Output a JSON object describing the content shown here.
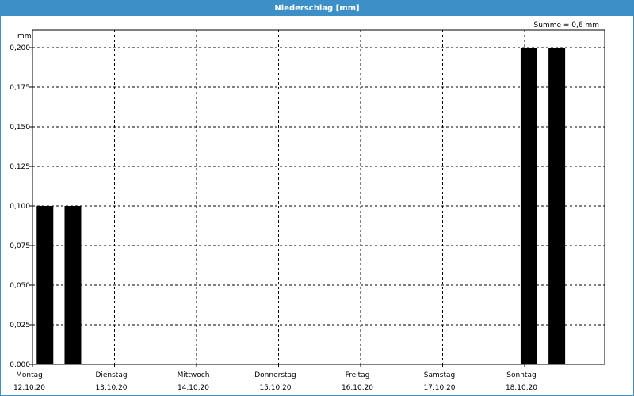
{
  "window": {
    "title": "Niederschlag [mm]"
  },
  "chart_data": {
    "type": "bar",
    "title": "Niederschlag [mm]",
    "unit_label": "mm",
    "sum_label": "Summe = 0,6 mm",
    "ylim": [
      0,
      0.2
    ],
    "y_ticks": [
      "0,000",
      "0,025",
      "0,050",
      "0,075",
      "0,100",
      "0,125",
      "0,150",
      "0,175",
      "0,200"
    ],
    "x_labels": [
      {
        "day": "Montag",
        "date": "12.10.20"
      },
      {
        "day": "Dienstag",
        "date": "13.10.20"
      },
      {
        "day": "Mittwoch",
        "date": "14.10.20"
      },
      {
        "day": "Donnerstag",
        "date": "15.10.20"
      },
      {
        "day": "Freitag",
        "date": "16.10.20"
      },
      {
        "day": "Samstag",
        "date": "17.10.20"
      },
      {
        "day": "Sonntag",
        "date": "18.10.20"
      }
    ],
    "x_range_days": [
      0,
      7
    ],
    "bars": [
      {
        "day_offset": 0.08,
        "value": 0.1
      },
      {
        "day_offset": 0.42,
        "value": 0.1
      },
      {
        "day_offset": 5.98,
        "value": 0.2
      },
      {
        "day_offset": 6.32,
        "value": 0.2
      }
    ],
    "grid": true,
    "bar_color": "#000000"
  }
}
